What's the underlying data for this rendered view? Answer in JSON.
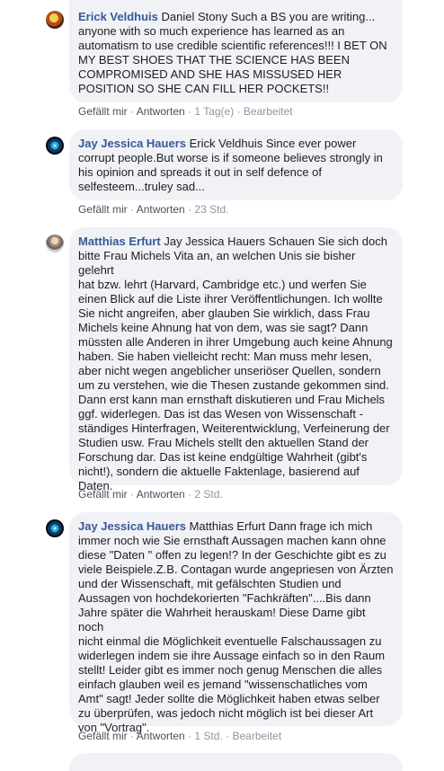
{
  "comments": [
    {
      "author": "Erick Veldhuis",
      "text": " Daniel Stony Such a BS you are writing...\nanyone with so much experience has learned as an\nautomatism to use credible scientific references!!! I BET ON\nMY BEST SHOES THAT THE SCIENCE HAS BEEN\nCOMPROMISED AND SHE HAS MISSUSED HER\nPOSITION SO SHE CAN FILL HER POCKETS!!",
      "like": "Gefällt mir",
      "reply": "Antworten",
      "time": "1 Tag(e)",
      "edited": "Bearbeitet"
    },
    {
      "author": "Jay Jessica Hauers",
      "text": " Erick Veldhuis Since ever power\ncorrupt people.But worse is if someone believes strongly in\nhis opinion and spreads it out in self defence of\nselfesteem...truley sad...",
      "like": "Gefällt mir",
      "reply": "Antworten",
      "time": "23 Std."
    },
    {
      "author": "Matthias Erfurt",
      "text": " Jay Jessica Hauers Schauen Sie sich doch\nbitte Frau Michels Vita an, an welchen Unis sie bisher gelehrt\nhat bzw. lehrt (Harvard, Cambridge etc.) und werfen Sie\neinen Blick auf die Liste ihrer Veröffentlichungen. Ich wollte\nSie nicht angreifen, aber glauben Sie wirklich, dass Frau\nMichels keine Ahnung hat von dem, was sie sagt? Dann\nmüssten alle Anderen in ihrer Umgebung auch keine Ahnung\nhaben. Sie haben vielleicht recht: Man muss mehr lesen,\naber nicht wegen angeblicher unseriöser Quellen, sondern\num zu verstehen, wie die Thesen zustande gekommen sind.\nDann erst kann man ernsthaft diskutieren und Frau Michels\nggf. widerlegen. Das ist das Wesen von Wissenschaft -\nständiges Hinterfragen, Weiterentwicklung, Verfeinerung der\nStudien usw. Frau Michels stellt den aktuellen Stand der\nForschung dar. Das ist keine endgültige Wahrheit (gibt's\nnicht!), sondern die aktuelle Faktenlage, basierend auf\nDaten.",
      "like": "Gefällt mir",
      "reply": "Antworten",
      "time": "2 Std."
    },
    {
      "author": "Jay Jessica Hauers",
      "text": " Matthias Erfurt Dann frage ich mich\nimmer noch wie Sie ernsthaft Aussagen machen kann ohne\ndiese \"Daten \" offen zu legen!? In der Geschichte gibt es zu\nviele Beispiele.Z.B. Contagan wurde angepriesen von Ärzten\nund der Wissenschaft, mit gefälschten Studien und\nAussagen von hochdekorierten \"Fachkräften\"....Bis dann\nJahre später die Wahrheit herauskam! Diese Dame gibt noch\nnicht einmal die Möglichkeit eventuelle Falschaussagen zu\nwiderlegen indem sie ihre Aussage einfach so in den Raum\nstellt! Leider gibt es immer noch genug Menschen die alles\neinfach glauben weil es jemand \"wissenschatliches vom\nAmt\" sagt! Jeder sollte die Möglichkeit haben etwas selber\nzu überprüfen, was jedoch nicht möglich ist bei dieser Art\nvon \"Vortrag\".",
      "like": "Gefällt mir",
      "reply": "Antworten",
      "time": "1 Std.",
      "edited": "Bearbeitet"
    }
  ],
  "separator": "·",
  "colors": {
    "author": "#385898",
    "bubble": "#f0f2f5",
    "text": "#1c1e21",
    "meta": "#65676b"
  }
}
